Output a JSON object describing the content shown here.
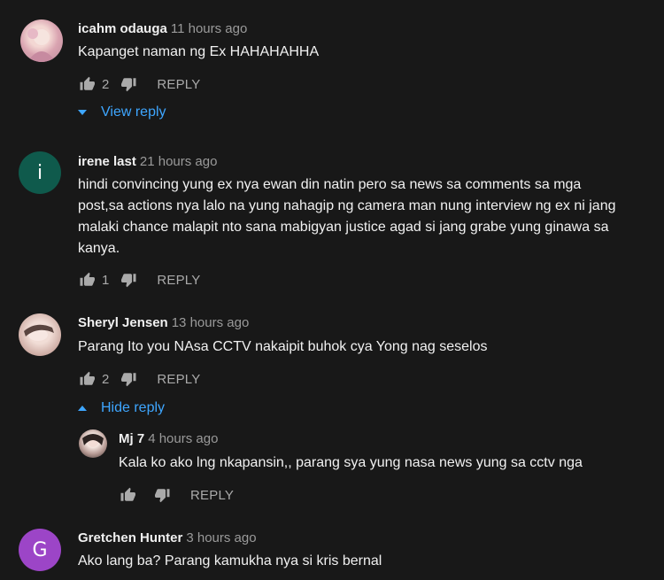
{
  "colors": {
    "accent": "#3ea6ff",
    "background": "#181818"
  },
  "comments": [
    {
      "author": "icahm odauga",
      "time": "11 hours ago",
      "text": "Kapanget naman ng Ex HAHAHAHHA",
      "likes": "2",
      "reply_label": "REPLY",
      "toggle_label": "View reply"
    },
    {
      "author": "irene last",
      "time": "21 hours ago",
      "avatar_letter": "i",
      "avatar_color": "#0f5a4c",
      "text": "hindi convincing yung ex nya ewan din natin pero sa news sa comments sa mga post,sa actions nya lalo na yung nahagip ng camera man nung interview ng ex ni jang malaki chance malapit nto sana mabigyan justice agad si jang grabe yung ginawa sa kanya.",
      "likes": "1",
      "reply_label": "REPLY"
    },
    {
      "author": "Sheryl Jensen",
      "time": "13 hours ago",
      "text": "Parang Ito you NAsa CCTV nakaipit buhok cya Yong nag seselos",
      "likes": "2",
      "reply_label": "REPLY",
      "toggle_label": "Hide reply"
    },
    {
      "author": "Mj 7",
      "time": "4 hours ago",
      "text": "Kala ko ako lng nkapansin,, parang sya yung nasa news yung sa cctv nga",
      "likes": "",
      "reply_label": "REPLY"
    },
    {
      "author": "Gretchen Hunter",
      "time": "3 hours ago",
      "avatar_letter": "G",
      "avatar_color": "#9c45c7",
      "text": "Ako lang ba? Parang kamukha nya si kris bernal"
    }
  ]
}
